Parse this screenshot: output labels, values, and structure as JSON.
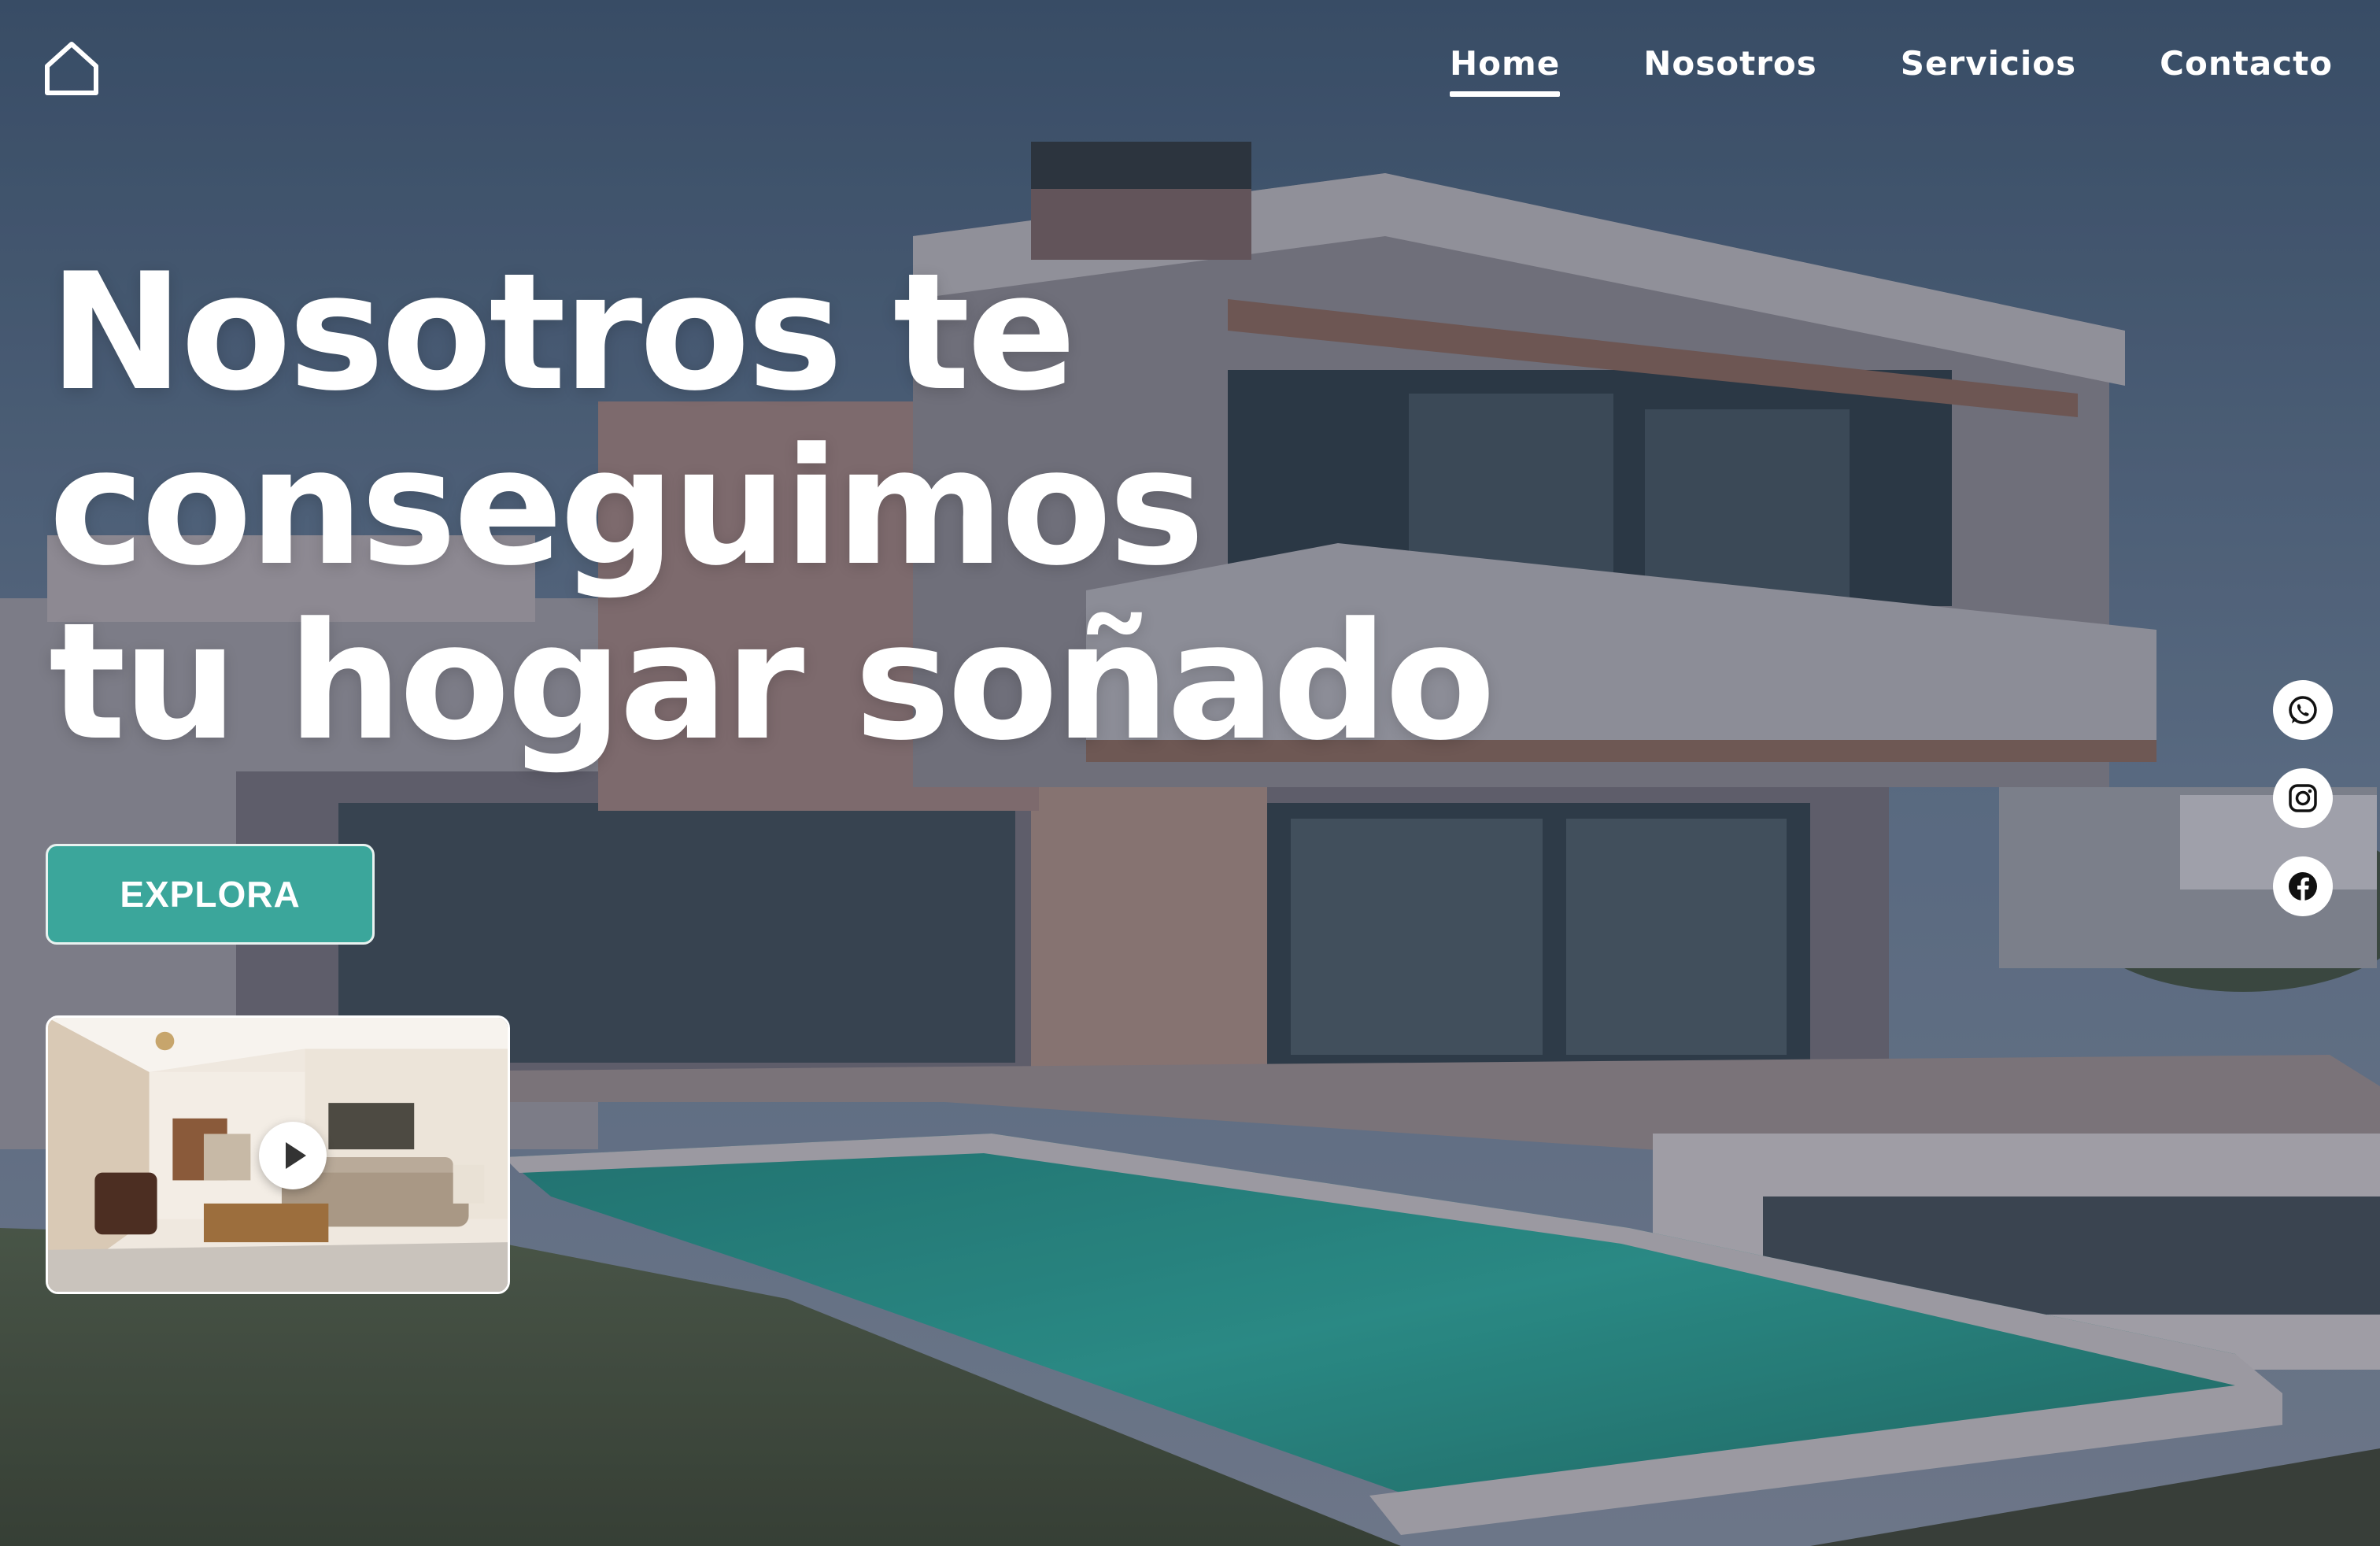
{
  "nav": {
    "items": [
      {
        "label": "Home",
        "active": true
      },
      {
        "label": "Nosotros",
        "active": false
      },
      {
        "label": "Servicios",
        "active": false
      },
      {
        "label": "Contacto",
        "active": false
      }
    ],
    "logo_icon": "home-outline-icon"
  },
  "hero": {
    "headline_lines": [
      "Nosotros te",
      "conseguimos",
      "tu hogar soñado"
    ],
    "cta_label": "EXPLORA",
    "video_icon": "play-icon"
  },
  "socials": [
    {
      "icon": "whatsapp-icon"
    },
    {
      "icon": "instagram-icon"
    },
    {
      "icon": "facebook-icon"
    }
  ],
  "colors": {
    "accent": "#3ba69b",
    "text": "#ffffff",
    "overlay": "#4a5b6d"
  }
}
